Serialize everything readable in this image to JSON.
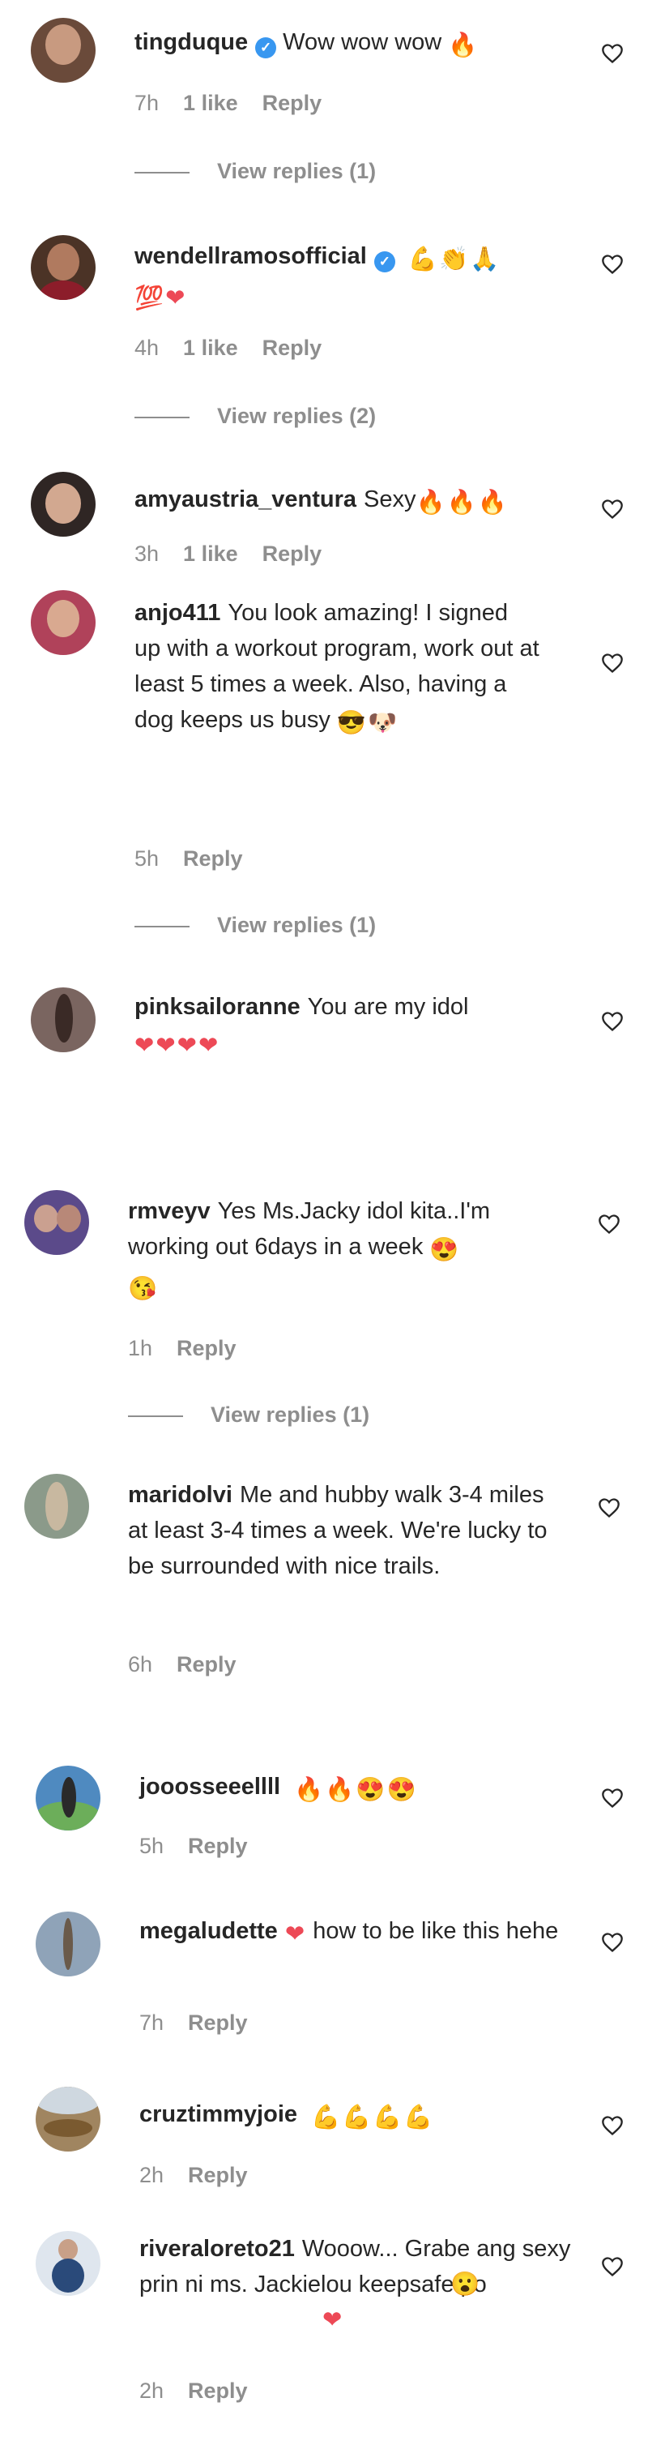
{
  "comments": [
    {
      "username": "tingduque",
      "verified": true,
      "text": "Wow wow wow",
      "emoji": [
        "fire"
      ],
      "time": "7h",
      "likes": "1 like",
      "reply": "Reply",
      "view_replies": "View replies (1)",
      "avatar_color": "#6a4a3a"
    },
    {
      "username": "wendellramosofficial",
      "verified": true,
      "text": "",
      "emoji": [
        "muscle",
        "clap",
        "pray",
        "100",
        "heart"
      ],
      "time": "4h",
      "likes": "1 like",
      "reply": "Reply",
      "view_replies": "View replies (2)",
      "avatar_color": "#4b3326"
    },
    {
      "username": "amyaustria_ventura",
      "verified": false,
      "text": "Sexy",
      "emoji": [
        "fire",
        "fire",
        "fire"
      ],
      "time": "3h",
      "likes": "1 like",
      "reply": "Reply",
      "view_replies": "",
      "avatar_color": "#2f2624"
    },
    {
      "username": "anjo411",
      "verified": false,
      "text": "You look amazing! I signed up with a workout program, work out at least 5 times a week. Also, having a dog keeps us busy",
      "emoji": [
        "sunglasses",
        "dog"
      ],
      "time": "5h",
      "likes": "",
      "reply": "Reply",
      "view_replies": "View replies (1)",
      "avatar_color": "#b0425a"
    },
    {
      "username": "pinksailoranne",
      "verified": false,
      "text": "You are my idol",
      "emoji": [
        "heart",
        "heart",
        "heart",
        "heart"
      ],
      "time": "",
      "likes": "",
      "reply": "",
      "view_replies": "",
      "avatar_color": "#7a6560"
    },
    {
      "username": "rmveyv",
      "verified": false,
      "text": "Yes Ms.Jacky idol kita..I'm working out 6days in a week",
      "emoji": [
        "heart-eyes",
        "wink-kiss"
      ],
      "time": "1h",
      "likes": "",
      "reply": "Reply",
      "view_replies": "View replies (1)",
      "avatar_color": "#5b4a8a"
    },
    {
      "username": "maridolvi",
      "verified": false,
      "text": "Me and hubby walk 3-4 miles at least 3-4 times a week. We're lucky to be surrounded with nice trails.",
      "emoji": [],
      "time": "6h",
      "likes": "",
      "reply": "Reply",
      "view_replies": "",
      "avatar_color": "#8b9a8a"
    },
    {
      "username": "jooosseeellll",
      "verified": false,
      "text": "",
      "emoji": [
        "fire",
        "fire",
        "heart-eyes",
        "heart-eyes"
      ],
      "time": "5h",
      "likes": "",
      "reply": "Reply",
      "view_replies": "",
      "avatar_color": "#4f8ac0"
    },
    {
      "username": "megaludette",
      "verified": false,
      "text": "how to be like this hehe",
      "emoji": [
        "heart"
      ],
      "time": "7h",
      "likes": "",
      "reply": "Reply",
      "view_replies": "",
      "avatar_color": "#8fa3b8"
    },
    {
      "username": "cruztimmyjoie",
      "verified": false,
      "text": "",
      "emoji": [
        "muscle",
        "muscle",
        "muscle",
        "muscle"
      ],
      "time": "2h",
      "likes": "",
      "reply": "Reply",
      "view_replies": "",
      "avatar_color": "#a08560"
    },
    {
      "username": "riveraloreto21",
      "verified": false,
      "text": "Wooow... Grabe ang sexy prin ni ms. Jackielou keepsafe po",
      "emoji": [
        "surprised",
        "heart"
      ],
      "time": "2h",
      "likes": "",
      "reply": "Reply",
      "view_replies": "",
      "avatar_color": "#5a7fa8"
    }
  ],
  "emoji_glyphs": {
    "fire": "🔥",
    "muscle": "💪",
    "clap": "👏",
    "pray": "🙏",
    "100": "💯",
    "heart": "❤",
    "sunglasses": "😎",
    "dog": "🐶",
    "heart-eyes": "😍",
    "wink-kiss": "😘",
    "surprised": "😮"
  },
  "colors": {
    "text": "#262626",
    "muted": "#8e8e8e",
    "verified": "#3897f0",
    "heart_red": "#ed4956",
    "fire": "#f97a1a"
  }
}
